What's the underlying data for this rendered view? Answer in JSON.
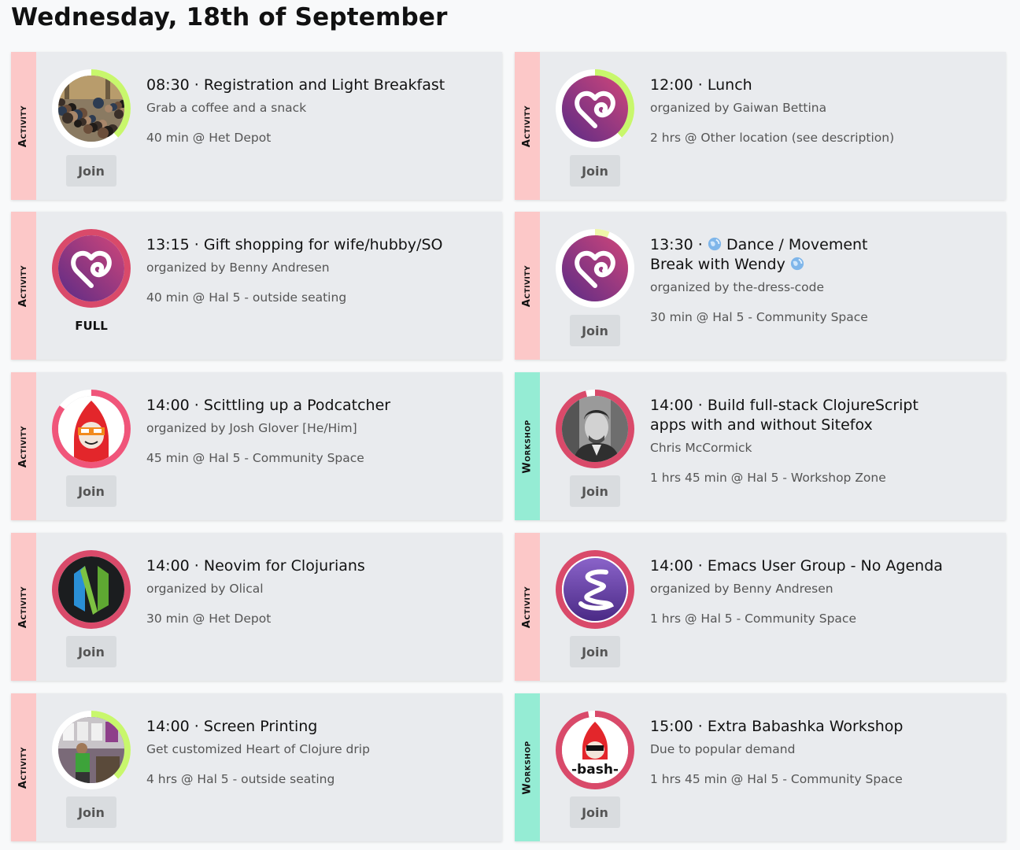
{
  "page": {
    "day_title": "Wednesday, 18th of September"
  },
  "colors": {
    "activity": "#fcc8c8",
    "workshop": "#95ecd4",
    "ring_pink": "#f0557a",
    "ring_green": "#c8f76c"
  },
  "sessions": [
    {
      "type": "Activity",
      "time": "08:30",
      "title": "Registration and Light Breakfast",
      "subtitle": "Grab a coffee and a snack",
      "meta": "40 min @ Het Depot",
      "action": "Join",
      "avatar_icon": "crowd-photo"
    },
    {
      "type": "Activity",
      "time": "12:00",
      "title": "Lunch",
      "subtitle": "organized by Gaiwan Bettina",
      "meta": "2 hrs @ Other location (see description)",
      "action": "Join",
      "avatar_icon": "heart-logo"
    },
    {
      "type": "Activity",
      "time": "13:15",
      "title": "Gift shopping for wife/hubby/SO",
      "subtitle": "organized by Benny Andresen",
      "meta": "40 min @ Hal 5 - outside seating",
      "action": "FULL",
      "avatar_icon": "heart-logo"
    },
    {
      "type": "Activity",
      "time": "13:30",
      "title": "Dance / Movement Break with Wendy",
      "subtitle": "organized by the-dress-code",
      "meta": "30 min @ Hal 5 - Community Space",
      "action": "Join",
      "avatar_icon": "heart-logo"
    },
    {
      "type": "Activity",
      "time": "14:00",
      "title": "Scittling up a Podcatcher",
      "subtitle": "organized by Josh Glover [He/Him]",
      "meta": "45 min @ Hal 5 - Community Space",
      "action": "Join",
      "avatar_icon": "red-hood-avatar"
    },
    {
      "type": "Workshop",
      "time": "14:00",
      "title": "Build full-stack ClojureScript apps with and without Sitefox",
      "subtitle": "Chris McCormick",
      "meta": "1 hrs 45 min @ Hal 5 - Workshop Zone",
      "action": "Join",
      "avatar_icon": "portrait-photo"
    },
    {
      "type": "Activity",
      "time": "14:00",
      "title": "Neovim for Clojurians",
      "subtitle": "organized by Olical",
      "meta": "30 min @ Het Depot",
      "action": "Join",
      "avatar_icon": "neovim-logo"
    },
    {
      "type": "Activity",
      "time": "14:00",
      "title": "Emacs User Group - No Agenda",
      "subtitle": "organized by Benny Andresen",
      "meta": "1 hrs @ Hal 5 - Community Space",
      "action": "Join",
      "avatar_icon": "emacs-logo"
    },
    {
      "type": "Activity",
      "time": "14:00",
      "title": "Screen Printing",
      "subtitle": "Get customized Heart of Clojure drip",
      "meta": "4 hrs @ Hal 5 - outside seating",
      "action": "Join",
      "avatar_icon": "screenprint-photo"
    },
    {
      "type": "Workshop",
      "time": "15:00",
      "title": "Extra Babashka Workshop",
      "subtitle": "Due to popular demand",
      "meta": "1 hrs 45 min @ Hal 5 - Community Space",
      "action": "Join",
      "avatar_icon": "babashka-logo",
      "logo_text": "-bash-"
    }
  ]
}
